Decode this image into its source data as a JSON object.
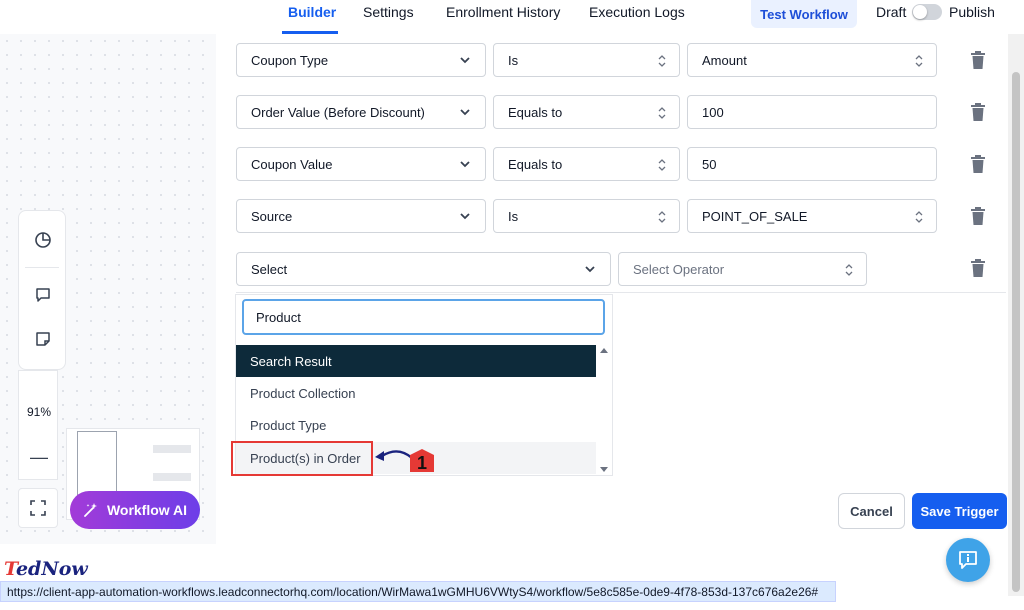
{
  "nav": {
    "tabs": [
      "Builder",
      "Settings",
      "Enrollment History",
      "Execution Logs"
    ],
    "test_workflow": "Test Workflow",
    "draft": "Draft",
    "publish": "Publish"
  },
  "canvas": {
    "zoom": "91%",
    "minus": "—",
    "workflow_ai": "Workflow AI"
  },
  "conditions": [
    {
      "field": "Coupon Type",
      "operator": "Is",
      "value": "Amount"
    },
    {
      "field": "Order Value (Before Discount)",
      "operator": "Equals to",
      "value": "100"
    },
    {
      "field": "Coupon Value",
      "operator": "Equals to",
      "value": "50"
    },
    {
      "field": "Source",
      "operator": "Is",
      "value": "POINT_OF_SALE"
    }
  ],
  "new_condition": {
    "field": "Select",
    "operator_placeholder": "Select Operator"
  },
  "dropdown": {
    "search_value": "Product",
    "group_header": "Search Result",
    "options": [
      "Product Collection",
      "Product Type",
      "Product(s) in Order"
    ]
  },
  "annotation": {
    "number": "1"
  },
  "buttons": {
    "cancel": "Cancel",
    "save": "Save Trigger"
  },
  "footer": {
    "brand_t": "T",
    "brand_rest": "edNow",
    "status_url": "https://client-app-automation-workflows.leadconnectorhq.com/location/WirMawa1wGMHU6VWtyS4/workflow/5e8c585e-0de9-4f78-853d-137c676a2e26#"
  },
  "colors": {
    "primary": "#155eef",
    "header_dark": "#0d2a3a",
    "highlight_red": "#e53935",
    "ai_gradient_start": "#a23bd8",
    "ai_gradient_end": "#6d3ee8"
  }
}
